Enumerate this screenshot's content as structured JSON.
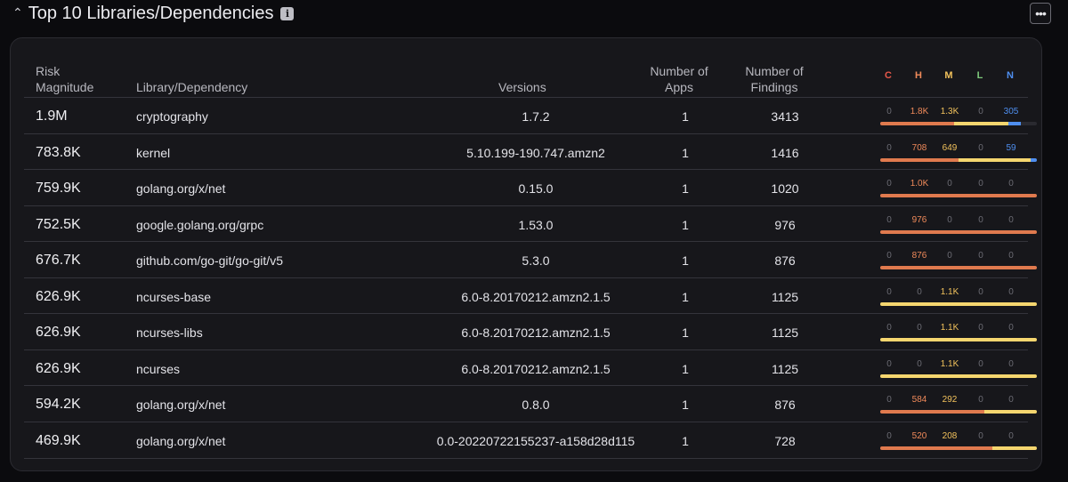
{
  "section": {
    "title": "Top 10 Libraries/Dependencies",
    "chevron_icon": "chevron-up-icon",
    "info_icon": "info-icon",
    "info_glyph": "i",
    "more_icon": "more-horizontal-icon",
    "more_glyph": "•••"
  },
  "table": {
    "headers": {
      "risk_line1": "Risk",
      "risk_line2": "Magnitude",
      "library": "Library/Dependency",
      "versions": "Versions",
      "apps_line1": "Number of",
      "apps_line2": "Apps",
      "findings_line1": "Number of",
      "findings_line2": "Findings",
      "sev_c": "C",
      "sev_h": "H",
      "sev_m": "M",
      "sev_l": "L",
      "sev_n": "N"
    },
    "severity_colors": {
      "C": "#e8584a",
      "H": "#f08a5a",
      "M": "#f2c25c",
      "L": "#7dc97b",
      "N": "#4f8ff0",
      "bar_H": "#e07a4e",
      "bar_M": "#f5d66f",
      "bar_N": "#4f8ff0"
    },
    "rows": [
      {
        "risk": "1.9M",
        "library": "cryptography",
        "version": "1.7.2",
        "apps": "1",
        "findings": "3413",
        "c": "0",
        "h": "1.8K",
        "m": "1.3K",
        "l": "0",
        "n": "305",
        "bar": [
          0,
          0.47,
          0.35,
          0,
          0.08
        ]
      },
      {
        "risk": "783.8K",
        "library": "kernel",
        "version": "5.10.199-190.747.amzn2",
        "apps": "1",
        "findings": "1416",
        "c": "0",
        "h": "708",
        "m": "649",
        "l": "0",
        "n": "59",
        "bar": [
          0,
          0.5,
          0.46,
          0,
          0.04
        ]
      },
      {
        "risk": "759.9K",
        "library": "golang.org/x/net",
        "version": "0.15.0",
        "apps": "1",
        "findings": "1020",
        "c": "0",
        "h": "1.0K",
        "m": "0",
        "l": "0",
        "n": "0",
        "bar": [
          0,
          1,
          0,
          0,
          0
        ]
      },
      {
        "risk": "752.5K",
        "library": "google.golang.org/grpc",
        "version": "1.53.0",
        "apps": "1",
        "findings": "976",
        "c": "0",
        "h": "976",
        "m": "0",
        "l": "0",
        "n": "0",
        "bar": [
          0,
          1,
          0,
          0,
          0
        ]
      },
      {
        "risk": "676.7K",
        "library": "github.com/go-git/go-git/v5",
        "version": "5.3.0",
        "apps": "1",
        "findings": "876",
        "c": "0",
        "h": "876",
        "m": "0",
        "l": "0",
        "n": "0",
        "bar": [
          0,
          1,
          0,
          0,
          0
        ]
      },
      {
        "risk": "626.9K",
        "library": "ncurses-base",
        "version": "6.0-8.20170212.amzn2.1.5",
        "apps": "1",
        "findings": "1125",
        "c": "0",
        "h": "0",
        "m": "1.1K",
        "l": "0",
        "n": "0",
        "bar": [
          0,
          0,
          1,
          0,
          0
        ]
      },
      {
        "risk": "626.9K",
        "library": "ncurses-libs",
        "version": "6.0-8.20170212.amzn2.1.5",
        "apps": "1",
        "findings": "1125",
        "c": "0",
        "h": "0",
        "m": "1.1K",
        "l": "0",
        "n": "0",
        "bar": [
          0,
          0,
          1,
          0,
          0
        ]
      },
      {
        "risk": "626.9K",
        "library": "ncurses",
        "version": "6.0-8.20170212.amzn2.1.5",
        "apps": "1",
        "findings": "1125",
        "c": "0",
        "h": "0",
        "m": "1.1K",
        "l": "0",
        "n": "0",
        "bar": [
          0,
          0,
          1,
          0,
          0
        ]
      },
      {
        "risk": "594.2K",
        "library": "golang.org/x/net",
        "version": "0.8.0",
        "apps": "1",
        "findings": "876",
        "c": "0",
        "h": "584",
        "m": "292",
        "l": "0",
        "n": "0",
        "bar": [
          0,
          0.667,
          0.333,
          0,
          0
        ]
      },
      {
        "risk": "469.9K",
        "library": "golang.org/x/net",
        "version": "0.0-20220722155237-a158d28d115",
        "apps": "1",
        "findings": "728",
        "c": "0",
        "h": "520",
        "m": "208",
        "l": "0",
        "n": "0",
        "bar": [
          0,
          0.714,
          0.286,
          0,
          0
        ]
      }
    ]
  }
}
